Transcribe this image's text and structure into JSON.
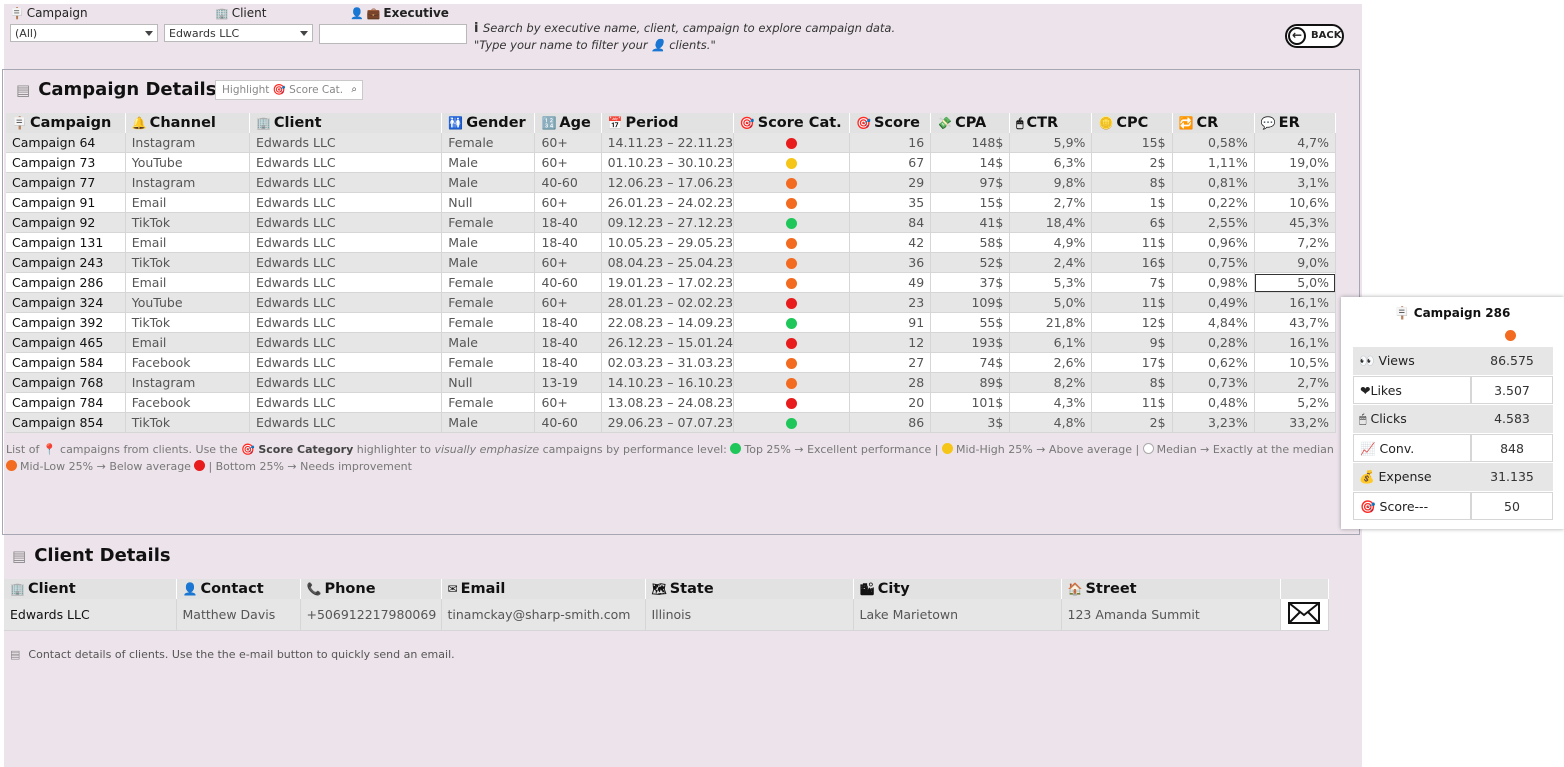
{
  "colors": {
    "red": "#e81c1c",
    "orange": "#f26b21",
    "yellow": "#f5c518",
    "green": "#1fc75a",
    "median": "#ffffff"
  },
  "filters": {
    "campaign_label": "Campaign",
    "client_label": "Client",
    "executive_label": "Executive",
    "campaign_value": "(All)",
    "client_value": "Edwards LLC",
    "executive_value": "",
    "hint": "Search by executive name, client, campaign to explore campaign data.  \"Type your name to filter your 👤 clients.\"",
    "back_label": "BACK"
  },
  "campaign_section": {
    "title": "Campaign Details",
    "highlight_placeholder": "Highlight 🎯 Score Cat.",
    "columns": [
      "Campaign",
      "Channel",
      "Client",
      "Gender",
      "Age",
      "Period",
      "Score Cat.",
      "Score",
      "CPA",
      "CTR",
      "CPC",
      "CR",
      "ER"
    ],
    "rows": [
      {
        "campaign": "Campaign 64",
        "channel": "Instagram",
        "client": "Edwards LLC",
        "gender": "Female",
        "age": "60+",
        "period": "14.11.23 – 22.11.23",
        "cat": "red",
        "score": "16",
        "cpa": "148$",
        "ctr": "5,9%",
        "cpc": "15$",
        "cr": "0,58%",
        "er": "4,7%"
      },
      {
        "campaign": "Campaign 73",
        "channel": "YouTube",
        "client": "Edwards LLC",
        "gender": "Male",
        "age": "60+",
        "period": "01.10.23 – 30.10.23",
        "cat": "yellow",
        "score": "67",
        "cpa": "14$",
        "ctr": "6,3%",
        "cpc": "2$",
        "cr": "1,11%",
        "er": "19,0%"
      },
      {
        "campaign": "Campaign 77",
        "channel": "Instagram",
        "client": "Edwards LLC",
        "gender": "Male",
        "age": "40-60",
        "period": "12.06.23 – 17.06.23",
        "cat": "orange",
        "score": "29",
        "cpa": "97$",
        "ctr": "9,8%",
        "cpc": "8$",
        "cr": "0,81%",
        "er": "3,1%"
      },
      {
        "campaign": "Campaign 91",
        "channel": "Email",
        "client": "Edwards LLC",
        "gender": "Null",
        "age": "60+",
        "period": "26.01.23 – 24.02.23",
        "cat": "orange",
        "score": "35",
        "cpa": "15$",
        "ctr": "2,7%",
        "cpc": "1$",
        "cr": "0,22%",
        "er": "10,6%"
      },
      {
        "campaign": "Campaign 92",
        "channel": "TikTok",
        "client": "Edwards LLC",
        "gender": "Female",
        "age": "18-40",
        "period": "09.12.23 – 27.12.23",
        "cat": "green",
        "score": "84",
        "cpa": "41$",
        "ctr": "18,4%",
        "cpc": "6$",
        "cr": "2,55%",
        "er": "45,3%"
      },
      {
        "campaign": "Campaign 131",
        "channel": "Email",
        "client": "Edwards LLC",
        "gender": "Male",
        "age": "18-40",
        "period": "10.05.23 – 29.05.23",
        "cat": "orange",
        "score": "42",
        "cpa": "58$",
        "ctr": "4,9%",
        "cpc": "11$",
        "cr": "0,96%",
        "er": "7,2%"
      },
      {
        "campaign": "Campaign 243",
        "channel": "TikTok",
        "client": "Edwards LLC",
        "gender": "Male",
        "age": "60+",
        "period": "08.04.23 – 25.04.23",
        "cat": "orange",
        "score": "36",
        "cpa": "52$",
        "ctr": "2,4%",
        "cpc": "16$",
        "cr": "0,75%",
        "er": "9,0%"
      },
      {
        "campaign": "Campaign 286",
        "channel": "Email",
        "client": "Edwards LLC",
        "gender": "Female",
        "age": "40-60",
        "period": "19.01.23 – 17.02.23",
        "cat": "orange",
        "score": "49",
        "cpa": "37$",
        "ctr": "5,3%",
        "cpc": "7$",
        "cr": "0,98%",
        "er": "5,0%"
      },
      {
        "campaign": "Campaign 324",
        "channel": "YouTube",
        "client": "Edwards LLC",
        "gender": "Female",
        "age": "60+",
        "period": "28.01.23 – 02.02.23",
        "cat": "red",
        "score": "23",
        "cpa": "109$",
        "ctr": "5,0%",
        "cpc": "11$",
        "cr": "0,49%",
        "er": "16,1%"
      },
      {
        "campaign": "Campaign 392",
        "channel": "TikTok",
        "client": "Edwards LLC",
        "gender": "Female",
        "age": "18-40",
        "period": "22.08.23 – 14.09.23",
        "cat": "green",
        "score": "91",
        "cpa": "55$",
        "ctr": "21,8%",
        "cpc": "12$",
        "cr": "4,84%",
        "er": "43,7%"
      },
      {
        "campaign": "Campaign 465",
        "channel": "Email",
        "client": "Edwards LLC",
        "gender": "Male",
        "age": "18-40",
        "period": "26.12.23 – 15.01.24",
        "cat": "red",
        "score": "12",
        "cpa": "193$",
        "ctr": "6,1%",
        "cpc": "9$",
        "cr": "0,28%",
        "er": "16,1%"
      },
      {
        "campaign": "Campaign 584",
        "channel": "Facebook",
        "client": "Edwards LLC",
        "gender": "Female",
        "age": "18-40",
        "period": "02.03.23 – 31.03.23",
        "cat": "orange",
        "score": "27",
        "cpa": "74$",
        "ctr": "2,6%",
        "cpc": "17$",
        "cr": "0,62%",
        "er": "10,5%"
      },
      {
        "campaign": "Campaign 768",
        "channel": "Instagram",
        "client": "Edwards LLC",
        "gender": "Null",
        "age": "13-19",
        "period": "14.10.23 – 16.10.23",
        "cat": "orange",
        "score": "28",
        "cpa": "89$",
        "ctr": "8,2%",
        "cpc": "8$",
        "cr": "0,73%",
        "er": "2,7%"
      },
      {
        "campaign": "Campaign 784",
        "channel": "Facebook",
        "client": "Edwards LLC",
        "gender": "Female",
        "age": "60+",
        "period": "13.08.23 – 24.08.23",
        "cat": "red",
        "score": "20",
        "cpa": "101$",
        "ctr": "4,3%",
        "cpc": "11$",
        "cr": "0,48%",
        "er": "5,2%"
      },
      {
        "campaign": "Campaign 854",
        "channel": "TikTok",
        "client": "Edwards LLC",
        "gender": "Male",
        "age": "40-60",
        "period": "29.06.23 – 07.07.23",
        "cat": "green",
        "score": "86",
        "cpa": "3$",
        "ctr": "4,8%",
        "cpc": "2$",
        "cr": "3,23%",
        "er": "33,2%"
      }
    ],
    "legend": {
      "intro": "List of 📍 campaigns from clients. Use the 🎯 ",
      "score_category": "Score Category",
      "mid": " highlighter to ",
      "visually": "visually emphasize",
      "tail": " campaigns by performance level: ",
      "top": "Top 25% → Excellent performance | ",
      "midhigh": "Mid-High 25% → Above average | ",
      "median": "Median → Exactly at the median",
      "midlow": "Mid-Low 25% → Below average ",
      "bottom": "| Bottom 25% → Needs improvement"
    }
  },
  "tooltip": {
    "title": "Campaign 286",
    "cat": "orange",
    "rows": [
      {
        "label": "👀 Views",
        "value": "86.575"
      },
      {
        "label": "❤Likes",
        "value": "3.507"
      },
      {
        "label": "🖱 Clicks",
        "value": "4.583"
      },
      {
        "label": "📈 Conv.",
        "value": "848"
      },
      {
        "label": "💰 Expense",
        "value": "31.135"
      },
      {
        "label": "🎯 Score---",
        "value": "50"
      }
    ]
  },
  "client_section": {
    "title": "Client Details",
    "columns": [
      "Client",
      "Contact",
      "Phone",
      "Email",
      "State",
      "City",
      "Street"
    ],
    "row": {
      "client": "Edwards LLC",
      "contact": "Matthew Davis",
      "phone": "+506912217980069",
      "email": "tinamckay@sharp-smith.com",
      "state": "Illinois",
      "city": "Lake Marietown",
      "street": "123 Amanda Summit"
    },
    "note": "Contact details of clients. Use the the e-mail button to quickly send an email."
  }
}
